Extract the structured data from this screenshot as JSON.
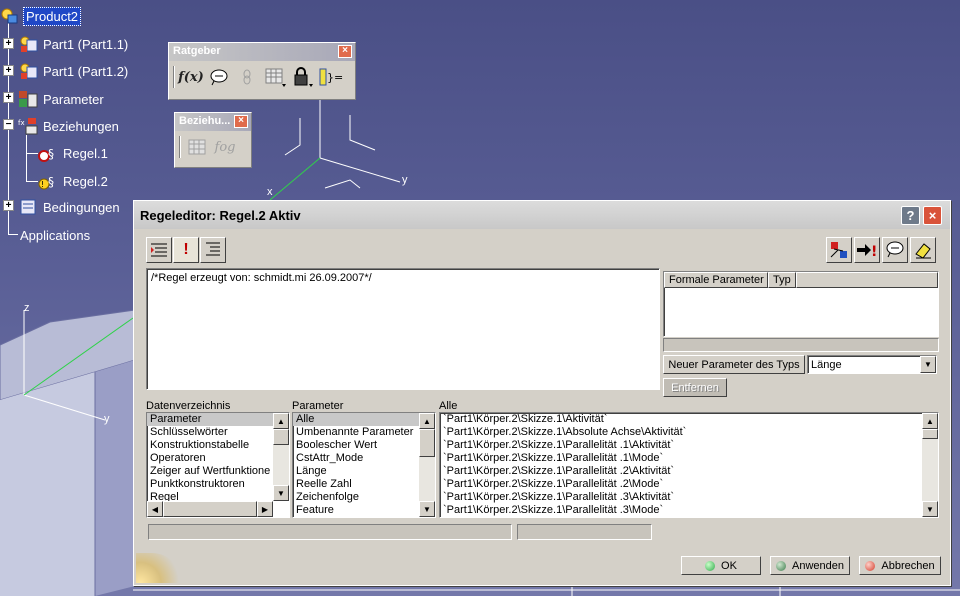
{
  "tree": {
    "items": [
      {
        "label": "Product2"
      },
      {
        "label": "Part1 (Part1.1)"
      },
      {
        "label": "Part1 (Part1.2)"
      },
      {
        "label": "Parameter"
      },
      {
        "label": "Beziehungen"
      },
      {
        "label": "Regel.1"
      },
      {
        "label": "Regel.2"
      },
      {
        "label": "Bedingungen"
      },
      {
        "label": "Applications"
      }
    ]
  },
  "toolbar_ratgeber": {
    "title": "Ratgeber",
    "close": "×",
    "icons": [
      "formula-icon",
      "comment-icon",
      "link-icon",
      "table-icon",
      "lock-icon",
      "rule-set-icon"
    ],
    "formula_glyph": "f(x)"
  },
  "toolbar_bezieh": {
    "title": "Beziehu...",
    "close": "×",
    "fog_glyph": "fog"
  },
  "axes": {
    "x": "x",
    "y": "y",
    "z": "z",
    "y2": "y"
  },
  "dialog": {
    "title": "Regeleditor: Regel.2 Aktiv",
    "help": "?",
    "close": "×",
    "rule_text": "/*Regel erzeugt von: schmidt.mi 26.09.2007*/",
    "formal_params": {
      "headers": [
        "Formale Parameter",
        "Typ"
      ]
    },
    "new_param_button": "Neuer Parameter des Typs",
    "type_select": "Länge",
    "remove_button": "Entfernen",
    "dictionary": {
      "label": "Datenverzeichnis",
      "items": [
        "Parameter",
        "Schlüsselwörter",
        "Konstruktionstabelle",
        "Operatoren",
        "Zeiger auf Wertfunktione",
        "Punktkonstruktoren",
        "Regel"
      ]
    },
    "parameter": {
      "label": "Parameter",
      "items": [
        "Alle",
        "Umbenannte Parameter",
        "Boolescher Wert",
        "CstAttr_Mode",
        "Länge",
        "Reelle Zahl",
        "Zeichenfolge",
        "Feature"
      ]
    },
    "alle": {
      "label": "Alle",
      "items": [
        "`Part1\\Körper.2\\Skizze.1\\Aktivität`",
        "`Part1\\Körper.2\\Skizze.1\\Absolute Achse\\Aktivität`",
        "`Part1\\Körper.2\\Skizze.1\\Parallelität .1\\Aktivität`",
        "`Part1\\Körper.2\\Skizze.1\\Parallelität .1\\Mode`",
        "`Part1\\Körper.2\\Skizze.1\\Parallelität .2\\Aktivität`",
        "`Part1\\Körper.2\\Skizze.1\\Parallelität .2\\Mode`",
        "`Part1\\Körper.2\\Skizze.1\\Parallelität .3\\Aktivität`",
        "`Part1\\Körper.2\\Skizze.1\\Parallelität .3\\Mode`"
      ]
    },
    "buttons": {
      "ok": "OK",
      "apply": "Anwenden",
      "cancel": "Abbrechen"
    },
    "colors": {
      "ok_led": "#2fa84a",
      "apply_led": "#3a7a4a",
      "cancel_led": "#d23a2a"
    }
  }
}
